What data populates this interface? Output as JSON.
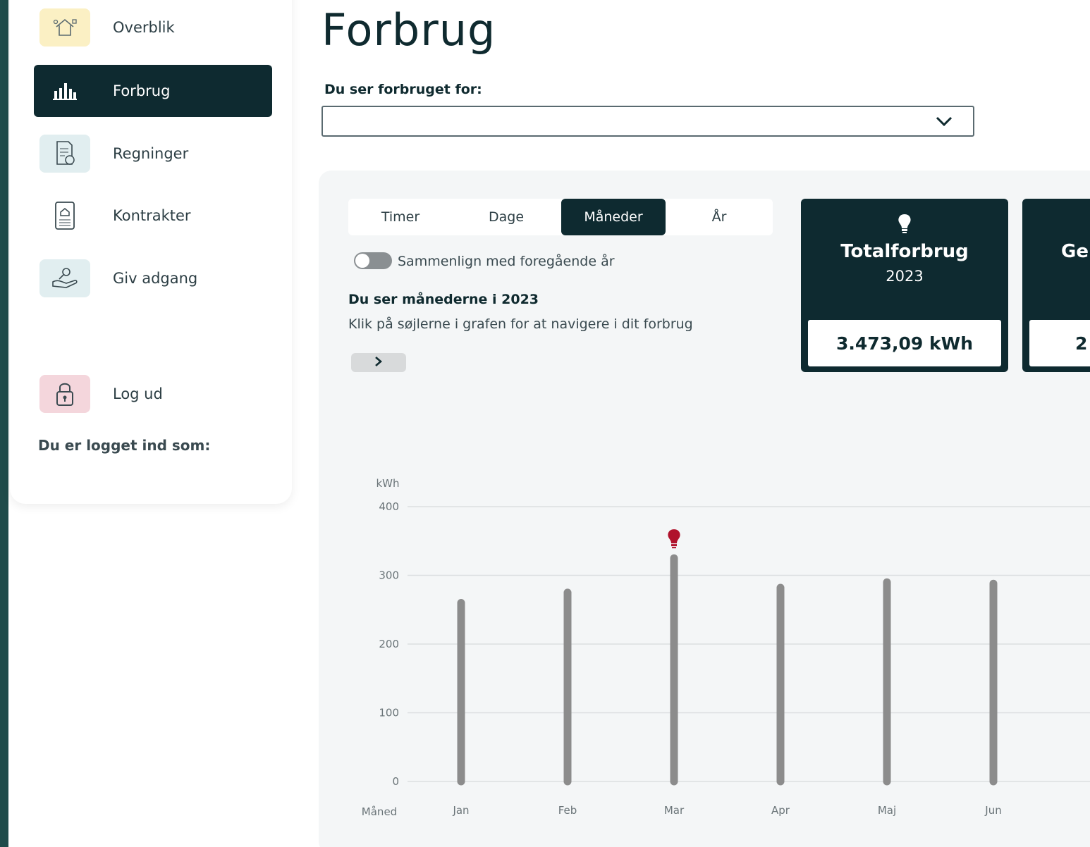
{
  "sidebar": {
    "items": [
      {
        "label": "Overblik",
        "icon": "house-icon"
      },
      {
        "label": "Forbrug",
        "icon": "bar-chart-icon",
        "active": true
      },
      {
        "label": "Regninger",
        "icon": "bill-icon"
      },
      {
        "label": "Kontrakter",
        "icon": "contract-icon"
      },
      {
        "label": "Giv adgang",
        "icon": "hand-key-icon"
      },
      {
        "label": "Log ud",
        "icon": "lock-icon"
      }
    ],
    "logged_in_text": "Du er logget ind som:"
  },
  "main": {
    "title": "Forbrug",
    "select_label": "Du ser forbruget for:",
    "select_value": "",
    "tabs": [
      {
        "label": "Timer"
      },
      {
        "label": "Dage"
      },
      {
        "label": "Måneder",
        "active": true
      },
      {
        "label": "År"
      }
    ],
    "compare_toggle_label": "Sammenlign med foregående år",
    "compare_toggle_on": false,
    "period_heading": "Du ser månederne i 2023",
    "period_hint": "Klik på søjlerne i grafen for at navigere i dit forbrug",
    "cards": [
      {
        "title": "Totalforbrug",
        "year": "2023",
        "value": "3.473,09 kWh"
      },
      {
        "title": "Ge",
        "year": "",
        "value": "2"
      }
    ]
  },
  "colors": {
    "dark": "#0e2a30",
    "bar": "#8c8c8c",
    "highlight": "#b0122c",
    "panel": "#f4f6f7"
  },
  "chart_data": {
    "type": "bar",
    "ylabel": "kWh",
    "xlabel": "Måned",
    "ylim": [
      0,
      400
    ],
    "yticks": [
      0,
      100,
      200,
      300,
      400
    ],
    "categories": [
      "Jan",
      "Feb",
      "Mar",
      "Apr",
      "Maj",
      "Jun"
    ],
    "values": [
      260,
      275,
      325,
      282,
      290,
      288
    ],
    "highlight_category": "Mar",
    "grid": true
  }
}
